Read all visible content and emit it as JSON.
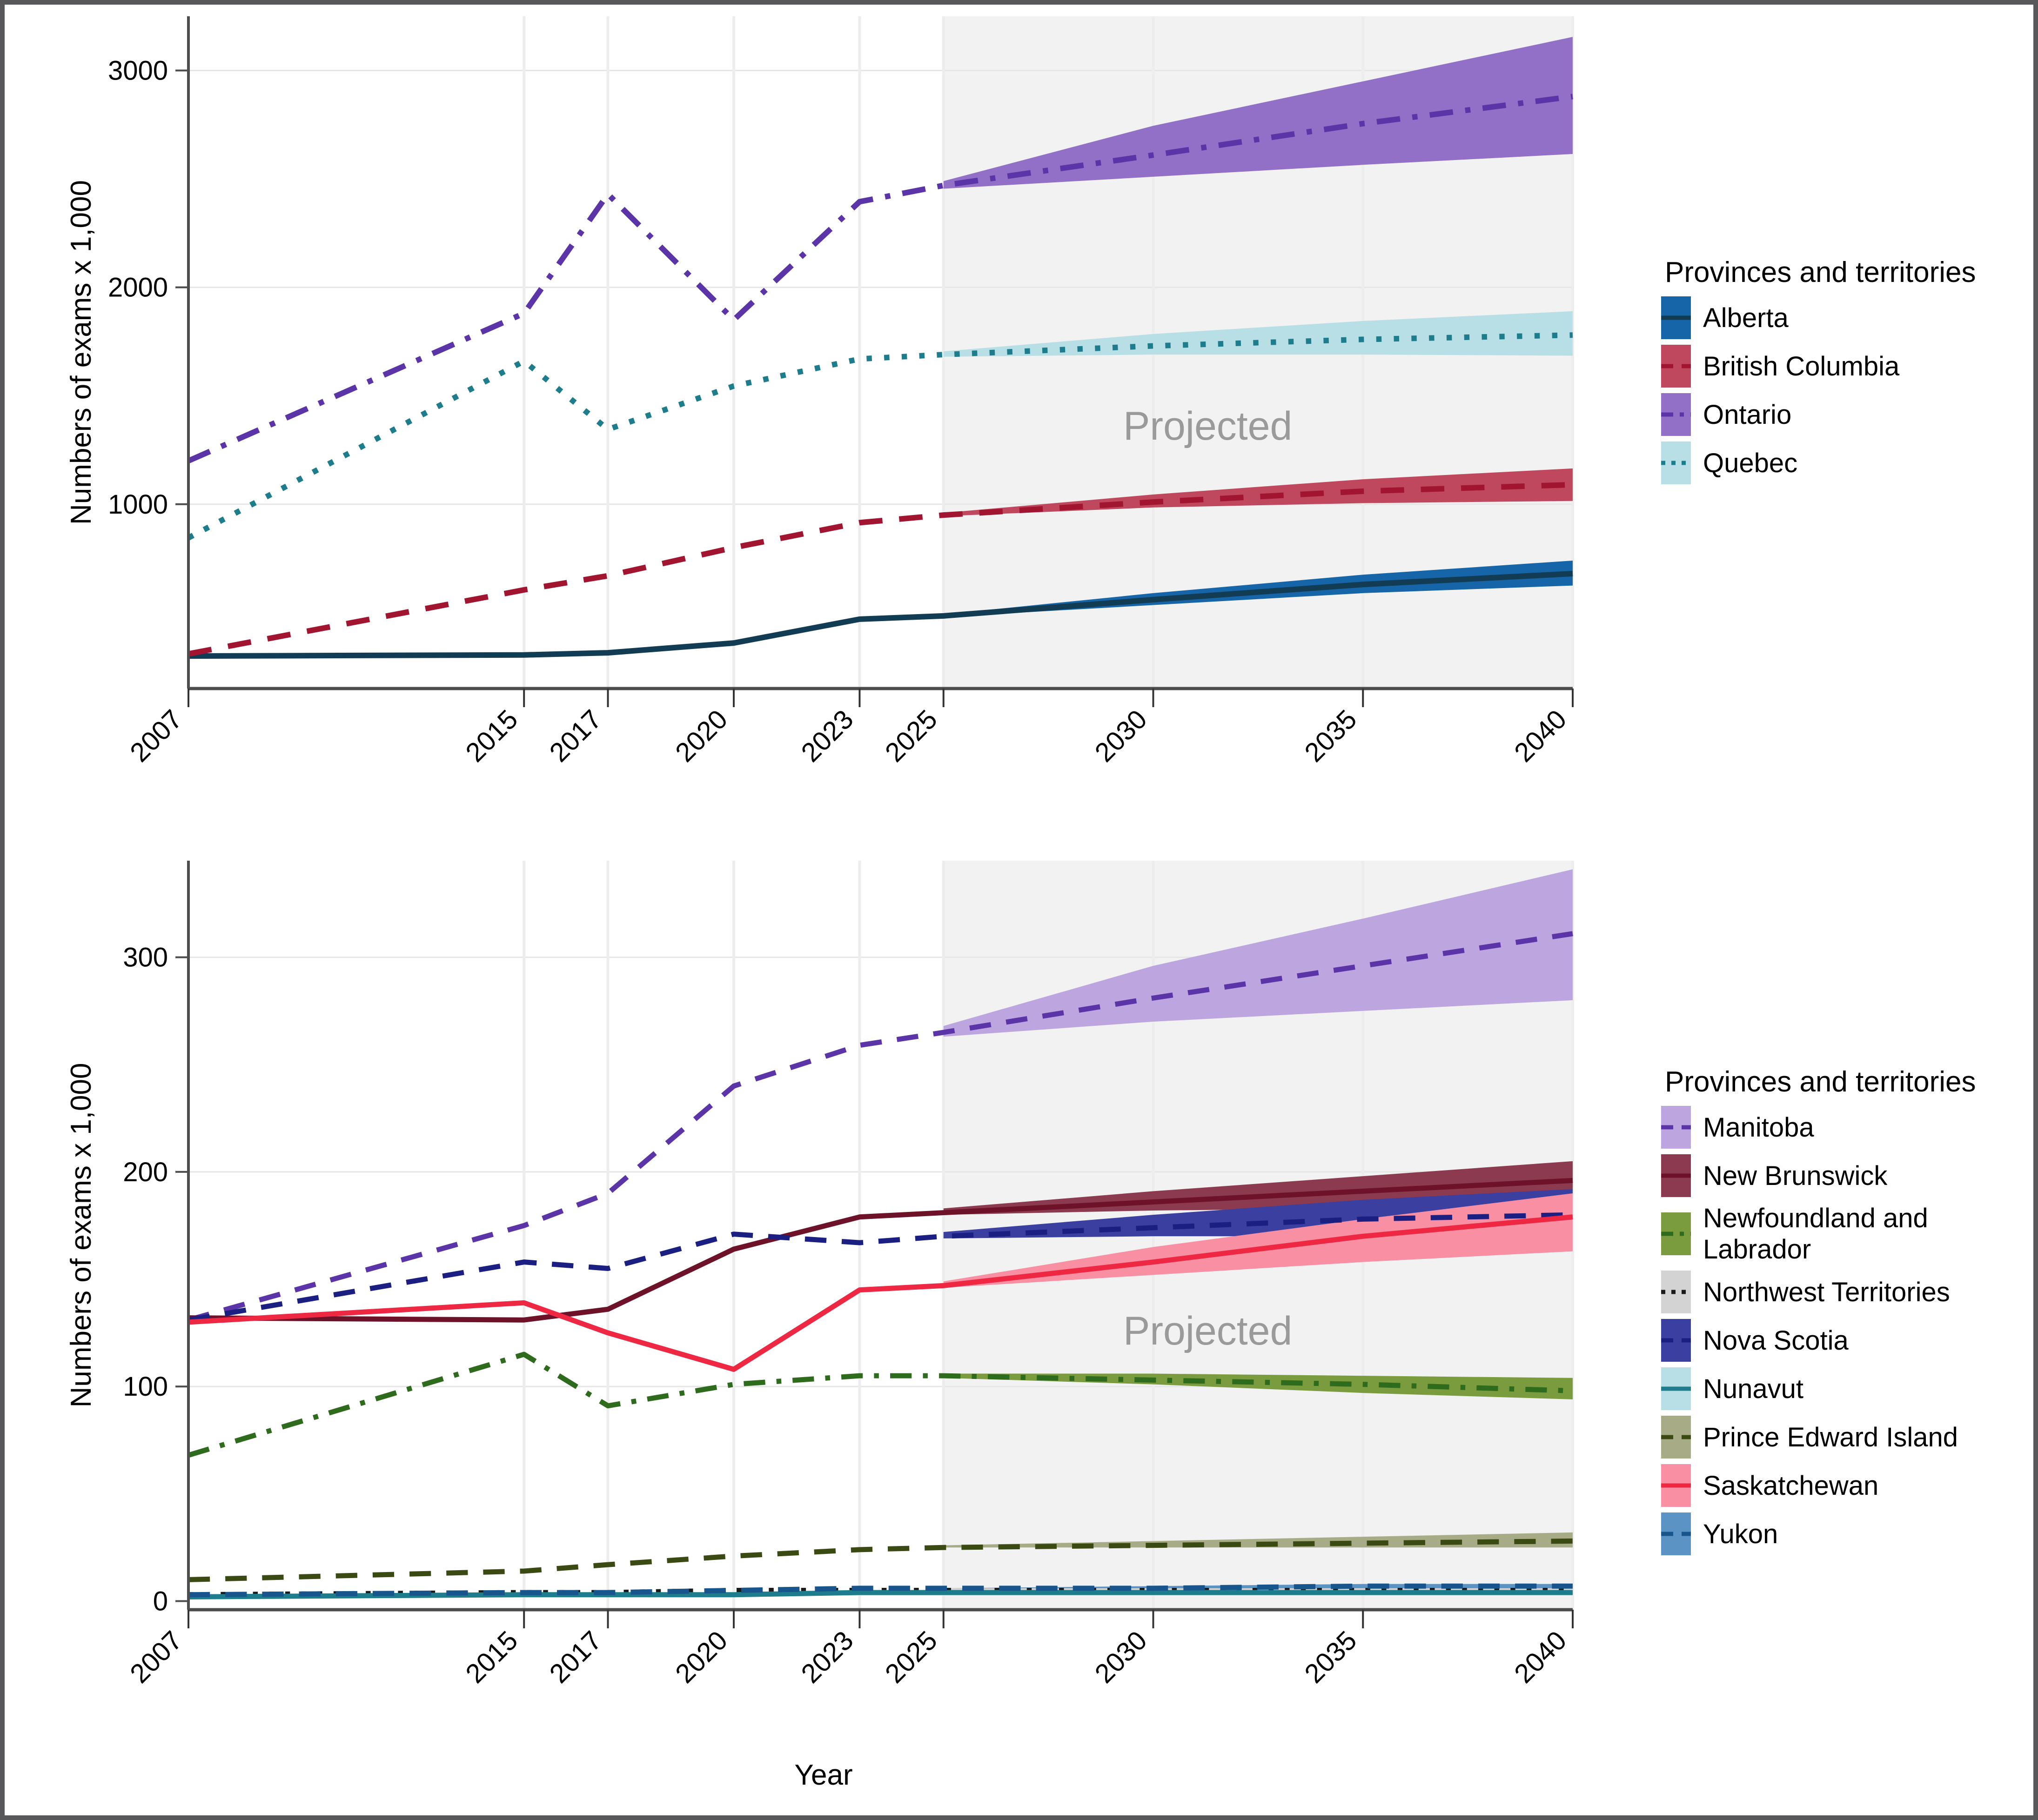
{
  "figure": {
    "x_axis_title": "Year",
    "projected_label": "Projected",
    "legend_title": "Provinces and territories",
    "border_color": "#58585a",
    "projected_band_color": "#f2f2f2",
    "gridline_color": "#e6e6e6"
  },
  "chart_data": [
    {
      "type": "line",
      "panel": "top",
      "title": "",
      "xlabel": "Year",
      "ylabel": "Numbers of exams x 1,000",
      "x": [
        2007,
        2015,
        2017,
        2020,
        2023,
        2025,
        2030,
        2035,
        2040
      ],
      "xticks": [
        "2007",
        "2015",
        "2017",
        "2020",
        "2023",
        "2025",
        "2030",
        "2035",
        "2040"
      ],
      "yticks": [
        1000,
        2000,
        3000
      ],
      "ylim": [
        150,
        3250
      ],
      "xlim": [
        2007,
        2040
      ],
      "grid": true,
      "legend_position": "right",
      "projection_start": 2025,
      "annotation": "Projected",
      "series": [
        {
          "name": "Alberta",
          "color": "#1565a8",
          "line_color": "#123b54",
          "dash": "solid",
          "values": [
            300,
            305,
            315,
            360,
            470,
            485,
            560,
            630,
            680
          ],
          "ci_low": [
            300,
            305,
            315,
            360,
            470,
            480,
            535,
            590,
            625
          ],
          "ci_high": [
            300,
            305,
            315,
            360,
            470,
            492,
            590,
            675,
            740
          ]
        },
        {
          "name": "British Columbia",
          "color": "#c0485e",
          "line_color": "#a11531",
          "dash": "dashed",
          "values": [
            310,
            605,
            670,
            800,
            915,
            950,
            1010,
            1060,
            1090
          ],
          "ci_low": [
            310,
            605,
            670,
            800,
            915,
            945,
            985,
            1005,
            1015
          ],
          "ci_high": [
            310,
            605,
            670,
            800,
            915,
            960,
            1045,
            1115,
            1165
          ]
        },
        {
          "name": "Ontario",
          "color": "#9370c8",
          "line_color": "#5b34a8",
          "dash": "dashdot",
          "values": [
            1200,
            1880,
            2430,
            1850,
            2395,
            2470,
            2610,
            2755,
            2880
          ],
          "ci_low": [
            1200,
            1880,
            2430,
            1850,
            2395,
            2455,
            2510,
            2565,
            2615
          ],
          "ci_high": [
            1200,
            1880,
            2430,
            1850,
            2395,
            2490,
            2745,
            2950,
            3155
          ]
        },
        {
          "name": "Quebec",
          "color": "#b8dfe6",
          "line_color": "#1e7d8c",
          "dash": "dotted",
          "values": [
            845,
            1660,
            1345,
            1545,
            1670,
            1690,
            1730,
            1760,
            1780
          ],
          "ci_low": [
            845,
            1660,
            1345,
            1545,
            1670,
            1680,
            1690,
            1690,
            1685
          ],
          "ci_high": [
            845,
            1660,
            1345,
            1545,
            1670,
            1705,
            1785,
            1845,
            1890
          ]
        }
      ]
    },
    {
      "type": "line",
      "panel": "bottom",
      "title": "",
      "xlabel": "Year",
      "ylabel": "Numbers of exams x 1,000",
      "x": [
        2007,
        2015,
        2017,
        2020,
        2023,
        2025,
        2030,
        2035,
        2040
      ],
      "xticks": [
        "2007",
        "2015",
        "2017",
        "2020",
        "2023",
        "2025",
        "2030",
        "2035",
        "2040"
      ],
      "yticks": [
        0,
        100,
        200,
        300
      ],
      "ylim": [
        -4,
        345
      ],
      "xlim": [
        2007,
        2040
      ],
      "grid": true,
      "legend_position": "right",
      "projection_start": 2025,
      "annotation": "Projected",
      "series": [
        {
          "name": "Manitoba",
          "color": "#bda5e0",
          "line_color": "#5b34a8",
          "dash": "dashed",
          "values": [
            131,
            175,
            190,
            240,
            259,
            265,
            281,
            296,
            311
          ],
          "ci_low": [
            131,
            175,
            190,
            240,
            259,
            263,
            270,
            275,
            280
          ],
          "ci_high": [
            131,
            175,
            190,
            240,
            259,
            268,
            296,
            318,
            341
          ]
        },
        {
          "name": "New Brunswick",
          "color": "#8c3a50",
          "line_color": "#6d1228",
          "dash": "solid",
          "values": [
            132,
            131,
            136,
            164,
            179,
            181,
            186,
            191,
            196
          ],
          "ci_low": [
            132,
            131,
            136,
            164,
            179,
            180,
            182,
            183,
            184
          ],
          "ci_high": [
            132,
            131,
            136,
            164,
            179,
            183,
            191,
            198,
            205
          ]
        },
        {
          "name": "Newfoundland and Labrador",
          "color": "#7a9c3f",
          "line_color": "#2f6b1c",
          "dash": "dashdot",
          "values": [
            68,
            115,
            91,
            101,
            105,
            105,
            103,
            101,
            98
          ],
          "ci_low": [
            68,
            115,
            91,
            101,
            105,
            104,
            101,
            97,
            94
          ],
          "ci_high": [
            68,
            115,
            91,
            101,
            105,
            106,
            106,
            105,
            104
          ]
        },
        {
          "name": "Northwest Territories",
          "color": "#d3d3d3",
          "line_color": "#1a1a1a",
          "dash": "dotted",
          "values": [
            3,
            4,
            4,
            5,
            5,
            5,
            5,
            5,
            5
          ],
          "ci_low": [
            3,
            4,
            4,
            5,
            5,
            5,
            5,
            4,
            4
          ],
          "ci_high": [
            3,
            4,
            4,
            5,
            5,
            6,
            6,
            6,
            6
          ]
        },
        {
          "name": "Nova Scotia",
          "color": "#3b3fa0",
          "line_color": "#1b1f82",
          "dash": "dashed",
          "values": [
            131,
            158,
            155,
            171,
            167,
            170,
            174,
            178,
            180
          ],
          "ci_low": [
            131,
            158,
            155,
            171,
            167,
            169,
            170,
            170,
            169
          ],
          "ci_high": [
            131,
            158,
            155,
            171,
            167,
            172,
            180,
            187,
            192
          ]
        },
        {
          "name": "Nunavut",
          "color": "#b8dfe6",
          "line_color": "#1e7d8c",
          "dash": "solid",
          "values": [
            2,
            3,
            3,
            3,
            4,
            4,
            4,
            4,
            4
          ],
          "ci_low": [
            2,
            3,
            3,
            3,
            4,
            4,
            4,
            4,
            4
          ],
          "ci_high": [
            2,
            3,
            3,
            3,
            4,
            4,
            5,
            5,
            5
          ]
        },
        {
          "name": "Prince Edward Island",
          "color": "#a8ac86",
          "line_color": "#3b4a12",
          "dash": "dashed",
          "values": [
            10,
            14,
            17,
            21,
            24,
            25,
            26,
            27,
            28
          ],
          "ci_low": [
            10,
            14,
            17,
            21,
            24,
            25,
            25,
            25,
            25
          ],
          "ci_high": [
            10,
            14,
            17,
            21,
            24,
            26,
            28,
            30,
            32
          ]
        },
        {
          "name": "Saskatchewan",
          "color": "#f98fa2",
          "line_color": "#ee2742",
          "dash": "solid",
          "values": [
            130,
            139,
            125,
            108,
            145,
            147,
            158,
            170,
            179
          ],
          "ci_low": [
            130,
            139,
            125,
            108,
            145,
            146,
            152,
            158,
            163
          ],
          "ci_high": [
            130,
            139,
            125,
            108,
            145,
            149,
            165,
            178,
            190
          ]
        },
        {
          "name": "Yukon",
          "color": "#5b93c4",
          "line_color": "#17558c",
          "dash": "dashed",
          "values": [
            3,
            4,
            4,
            5,
            6,
            6,
            6,
            7,
            7
          ],
          "ci_low": [
            3,
            4,
            4,
            5,
            6,
            6,
            6,
            6,
            6
          ],
          "ci_high": [
            3,
            4,
            4,
            5,
            6,
            6,
            7,
            8,
            8
          ]
        }
      ]
    }
  ]
}
